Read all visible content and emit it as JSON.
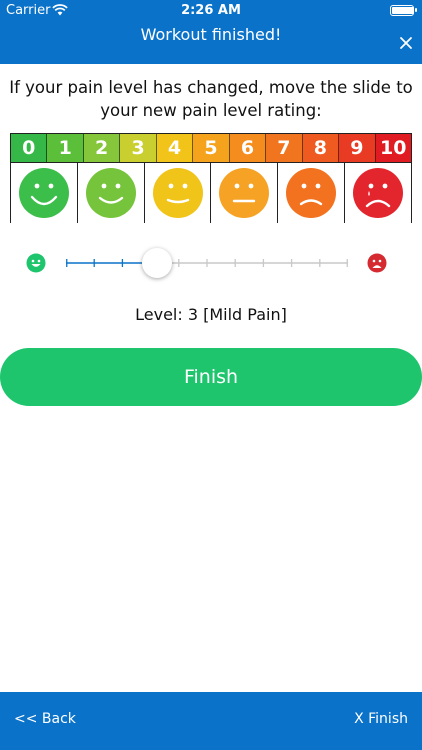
{
  "status_bar": {
    "carrier": "Carrier",
    "time": "2:26 AM",
    "battery_level": 1.0
  },
  "nav": {
    "title": "Workout finished!",
    "close_icon": "close-icon"
  },
  "prompt": {
    "line1": "If your pain level has changed, move the slide to",
    "line2": "your new pain level rating:"
  },
  "scale": {
    "numbers": [
      {
        "label": "0",
        "color": "#35b847"
      },
      {
        "label": "1",
        "color": "#5bbf3a"
      },
      {
        "label": "2",
        "color": "#86c63a"
      },
      {
        "label": "3",
        "color": "#c9cf2f"
      },
      {
        "label": "4",
        "color": "#f2c318"
      },
      {
        "label": "5",
        "color": "#f5a21c"
      },
      {
        "label": "6",
        "color": "#f58d1e"
      },
      {
        "label": "7",
        "color": "#f1751e"
      },
      {
        "label": "8",
        "color": "#ee5a1f"
      },
      {
        "label": "9",
        "color": "#e93a23"
      },
      {
        "label": "10",
        "color": "#e11b22"
      }
    ],
    "faces": [
      {
        "icon": "very-happy-face-icon",
        "color": "#3cbe4b",
        "mood": "big-smile"
      },
      {
        "icon": "happy-face-icon",
        "color": "#76c43c",
        "mood": "smile"
      },
      {
        "icon": "neutral-face-icon",
        "color": "#f0c419",
        "mood": "slight"
      },
      {
        "icon": "uneasy-face-icon",
        "color": "#f6a325",
        "mood": "flat"
      },
      {
        "icon": "sad-face-icon",
        "color": "#f2721f",
        "mood": "frown"
      },
      {
        "icon": "crying-face-icon",
        "color": "#e3262d",
        "mood": "cry"
      }
    ]
  },
  "slider": {
    "min": 0,
    "max": 10,
    "value": 3,
    "left_icon": "happy-face-icon",
    "right_icon": "sad-face-icon",
    "active_color": "#0a72c8",
    "inactive_color": "#c8c8c8"
  },
  "level": {
    "text": "Level: 3 [Mild Pain]"
  },
  "finish_button": {
    "label": "Finish",
    "color": "#1ec56d"
  },
  "bottom_bar": {
    "back_label": "<< Back",
    "finish_label": "X Finish"
  }
}
